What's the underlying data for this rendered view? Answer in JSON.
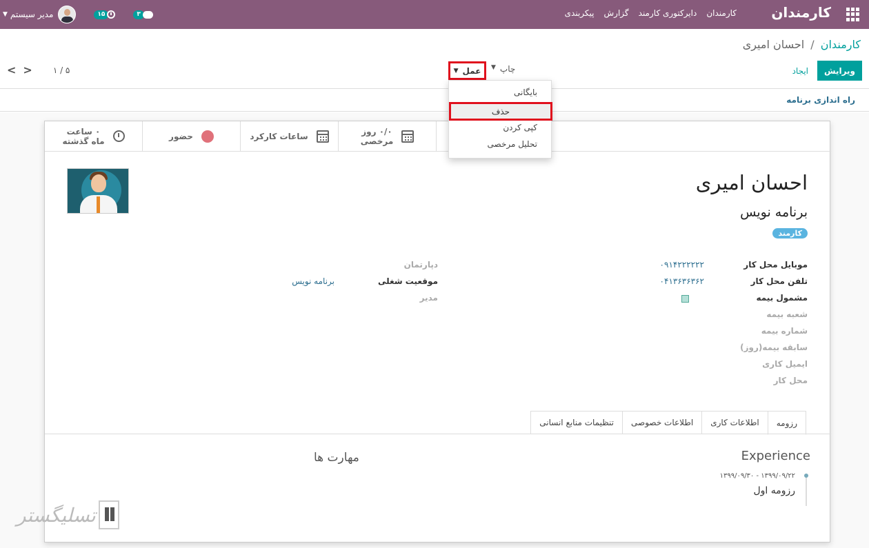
{
  "navbar": {
    "brand": "کارمندان",
    "menu": [
      "کارمندان",
      "دایرکتوری کارمند",
      "گزارش",
      "پیکربندی"
    ],
    "user_name": "مدیر سیستم",
    "activity_count": "۱۵",
    "message_count": "۳"
  },
  "breadcrumb": {
    "parent": "کارمندان",
    "separator": "/",
    "current": "احسان امیری"
  },
  "buttons": {
    "edit": "ویرایش",
    "create": "ایجاد",
    "print": "چاپ",
    "action": "عمل"
  },
  "pager": {
    "value": "۱ / ۵"
  },
  "status_bar": {
    "launch": "راه اندازی برنامه"
  },
  "action_menu": {
    "archive": "بایگانی",
    "delete": "حذف",
    "duplicate": "کپی کردن",
    "time_off_analysis": "تحلیل مرخصی"
  },
  "smart_buttons": {
    "time_off": {
      "value": "۰/۰ روز",
      "label": "مرخصی"
    },
    "worked_hours": "ساعات کارکرد",
    "presence": "حضور",
    "last_month": {
      "value": "۰ ساعت",
      "label": "ماه گذشته"
    }
  },
  "employee": {
    "name": "احسان امیری",
    "job_title": "برنامه نویس",
    "tag": "کارمند"
  },
  "fields_right": {
    "mobile_label": "موبایل محل کار",
    "mobile_value": "۰۹۱۴۲۲۲۲۲۲",
    "phone_label": "تلفن محل کار",
    "phone_value": "۰۴۱۳۶۳۶۳۶۲",
    "insured_label": "مشمول بیمه",
    "branch_label": "شعبه بیمه",
    "number_label": "شماره بیمه",
    "history_label": "سابقه بیمه(روز)",
    "email_label": "ایمیل کاری",
    "location_label": "محل کار"
  },
  "fields_left": {
    "department_label": "دپارتمان",
    "position_label": "موقعیت شغلی",
    "position_value": "برنامه نویس",
    "manager_label": "مدیر"
  },
  "tabs": [
    "رزومه",
    "اطلاعات کاری",
    "اطلاعات خصوصی",
    "تنظیمات منابع انسانی"
  ],
  "resume": {
    "experience_title": "Experience",
    "skills_title": "مهارت ها",
    "entry_dates": "۱۳۹۹/۰۹/۲۲ - ۱۳۹۹/۰۹/۳۰",
    "entry_name": "رزومه اول"
  },
  "watermark": {
    "text": "تسلیگستر"
  },
  "colors": {
    "navbar": "#875a7b",
    "primary": "#00a09d",
    "highlight": "#e0101d"
  }
}
